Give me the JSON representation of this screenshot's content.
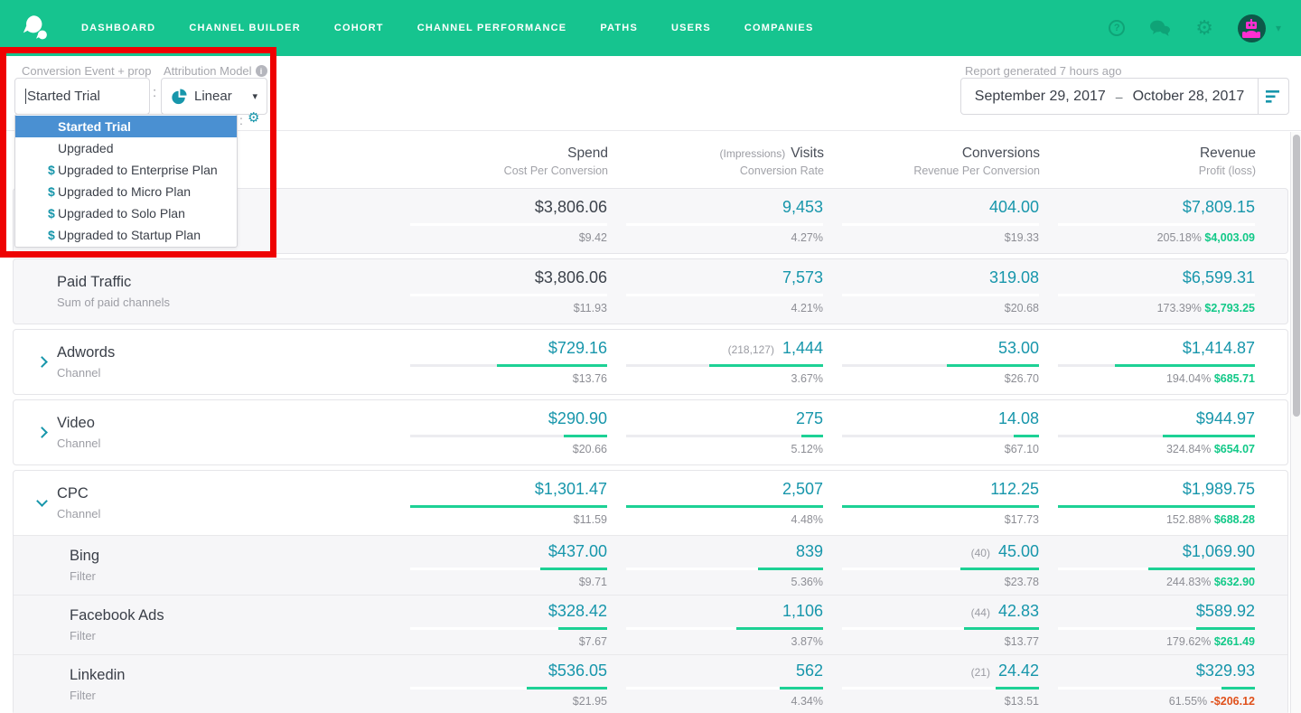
{
  "colors": {
    "nav_green": "#16c48f",
    "accent_teal": "#1796ab",
    "positive_green": "#12c988",
    "bar_green": "#1dd195",
    "negative_red": "#e0511c",
    "selected_blue": "#4a90d2",
    "annotation_red": "#ee0202"
  },
  "nav": {
    "logo_icon": "attribution-logo",
    "items": [
      "DASHBOARD",
      "CHANNEL BUILDER",
      "COHORT",
      "CHANNEL PERFORMANCE",
      "PATHS",
      "USERS",
      "COMPANIES"
    ],
    "right_icons": [
      "help-icon",
      "messages-icon",
      "settings-icon",
      "user-avatar",
      "caret-down-icon"
    ]
  },
  "filters": {
    "conversion_event_label": "Conversion Event  + prop",
    "conversion_event_value": "Started Trial",
    "separator": ":",
    "attribution_model_label": "Attribution Model",
    "attribution_model_value": "Linear",
    "second_row_separator": ":",
    "dropdown_items": [
      {
        "label": "Started Trial",
        "selected": true
      },
      {
        "label": "Upgraded"
      },
      {
        "label": "Upgraded to Enterprise Plan",
        "money": true
      },
      {
        "label": "Upgraded to Micro Plan",
        "money": true
      },
      {
        "label": "Upgraded to Solo Plan",
        "money": true
      },
      {
        "label": "Upgraded to Startup Plan",
        "money": true
      }
    ]
  },
  "report": {
    "generated_label": "Report generated 7 hours ago",
    "date_start": "September 29, 2017",
    "date_separator": "–",
    "date_end": "October 28, 2017"
  },
  "table": {
    "columns": [
      {
        "title": "Spend",
        "subtitle": "Cost Per Conversion"
      },
      {
        "prefix": "(Impressions)",
        "title": "Visits",
        "subtitle": "Conversion Rate"
      },
      {
        "title": "Conversions",
        "subtitle": "Revenue Per Conversion"
      },
      {
        "title": "Revenue",
        "subtitle": "Profit (loss)"
      }
    ],
    "cards": [
      {
        "gray": true,
        "rows": [
          {
            "name": "",
            "subtitle": "",
            "cells": [
              {
                "value": "$3,806.06",
                "sub": "$9.42",
                "dark": true,
                "fill": 0
              },
              {
                "value": "9,453",
                "sub": "4.27%",
                "fill": 0
              },
              {
                "value": "404.00",
                "sub": "$19.33",
                "fill": 0
              },
              {
                "value": "$7,809.15",
                "pct": "205.18%",
                "profit": "$4,003.09",
                "fill": 0
              }
            ]
          }
        ]
      },
      {
        "gray": true,
        "rows": [
          {
            "name": "Paid Traffic",
            "subtitle": "Sum of paid channels",
            "cells": [
              {
                "value": "$3,806.06",
                "sub": "$11.93",
                "dark": true,
                "fill": 0
              },
              {
                "value": "7,573",
                "sub": "4.21%",
                "fill": 0
              },
              {
                "value": "319.08",
                "sub": "$20.68",
                "fill": 0
              },
              {
                "value": "$6,599.31",
                "pct": "173.39%",
                "profit": "$2,793.25",
                "fill": 0
              }
            ]
          }
        ]
      },
      {
        "rows": [
          {
            "name": "Adwords",
            "subtitle": "Channel",
            "chevron": "right",
            "cells": [
              {
                "value": "$729.16",
                "sub": "$13.76",
                "fill": 56
              },
              {
                "prefix": "(218,127)",
                "value": "1,444",
                "sub": "3.67%",
                "fill": 58
              },
              {
                "value": "53.00",
                "sub": "$26.70",
                "fill": 47
              },
              {
                "value": "$1,414.87",
                "pct": "194.04%",
                "profit": "$685.71",
                "fill": 71
              }
            ]
          }
        ]
      },
      {
        "rows": [
          {
            "name": "Video",
            "subtitle": "Channel",
            "chevron": "right",
            "cells": [
              {
                "value": "$290.90",
                "sub": "$20.66",
                "fill": 22
              },
              {
                "value": "275",
                "sub": "5.12%",
                "fill": 11
              },
              {
                "value": "14.08",
                "sub": "$67.10",
                "fill": 13
              },
              {
                "value": "$944.97",
                "pct": "324.84%",
                "profit": "$654.07",
                "fill": 47
              }
            ]
          }
        ]
      },
      {
        "rows": [
          {
            "name": "CPC",
            "subtitle": "Channel",
            "chevron": "down",
            "cells": [
              {
                "value": "$1,301.47",
                "sub": "$11.59",
                "fill": 100
              },
              {
                "value": "2,507",
                "sub": "4.48%",
                "fill": 100
              },
              {
                "value": "112.25",
                "sub": "$17.73",
                "fill": 100
              },
              {
                "value": "$1,989.75",
                "pct": "152.88%",
                "profit": "$688.28",
                "fill": 100
              }
            ]
          },
          {
            "name": "Bing",
            "subtitle": "Filter",
            "cells": [
              {
                "value": "$437.00",
                "sub": "$9.71",
                "fill": 34
              },
              {
                "value": "839",
                "sub": "5.36%",
                "fill": 33
              },
              {
                "prefix": "(40)",
                "value": "45.00",
                "sub": "$23.78",
                "fill": 40
              },
              {
                "value": "$1,069.90",
                "pct": "244.83%",
                "profit": "$632.90",
                "fill": 54
              }
            ]
          },
          {
            "name": "Facebook Ads",
            "subtitle": "Filter",
            "cells": [
              {
                "value": "$328.42",
                "sub": "$7.67",
                "fill": 25
              },
              {
                "value": "1,106",
                "sub": "3.87%",
                "fill": 44
              },
              {
                "prefix": "(44)",
                "value": "42.83",
                "sub": "$13.77",
                "fill": 38
              },
              {
                "value": "$589.92",
                "pct": "179.62%",
                "profit": "$261.49",
                "fill": 30
              }
            ]
          },
          {
            "name": "Linkedin",
            "subtitle": "Filter",
            "cells": [
              {
                "value": "$536.05",
                "sub": "$21.95",
                "fill": 41
              },
              {
                "value": "562",
                "sub": "4.34%",
                "fill": 22
              },
              {
                "prefix": "(21)",
                "value": "24.42",
                "sub": "$13.51",
                "fill": 22
              },
              {
                "value": "$329.93",
                "pct": "61.55%",
                "profit": "-$206.12",
                "negative": true,
                "fill": 17
              }
            ]
          }
        ]
      }
    ]
  }
}
